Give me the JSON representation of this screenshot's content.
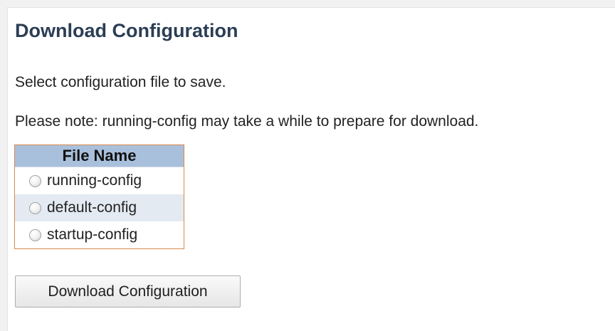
{
  "page": {
    "title": "Download Configuration",
    "instruction": "Select configuration file to save.",
    "note": "Please note: running-config may take a while to prepare for download."
  },
  "file_table": {
    "header": "File Name",
    "files": [
      {
        "name": "running-config",
        "selected": false
      },
      {
        "name": "default-config",
        "selected": false
      },
      {
        "name": "startup-config",
        "selected": false
      }
    ]
  },
  "actions": {
    "download_label": "Download Configuration"
  },
  "colors": {
    "title": "#2c3e55",
    "table_header_bg": "#a9c0dc",
    "table_border": "#d9894a",
    "alt_row_bg": "#e3eaf2"
  }
}
